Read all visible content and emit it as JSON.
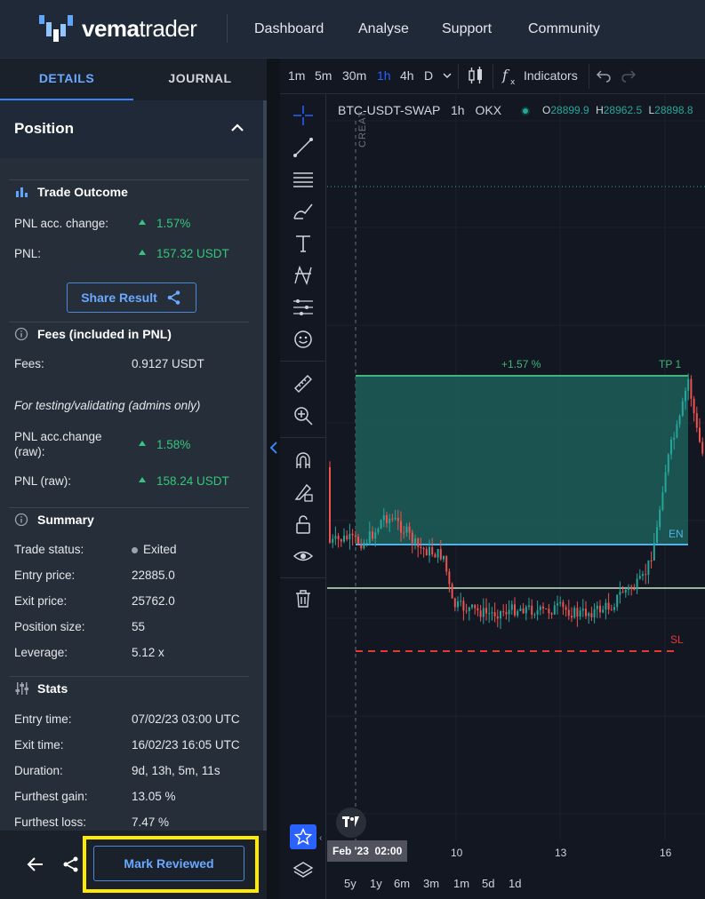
{
  "brand": {
    "name_light": "vema",
    "name_bold": "trader"
  },
  "nav": [
    "Dashboard",
    "Analyse",
    "Support",
    "Community"
  ],
  "tabs": {
    "details": "DETAILS",
    "journal": "JOURNAL"
  },
  "position": {
    "title": "Position"
  },
  "trade_outcome": {
    "title": "Trade Outcome",
    "pnl_acc_label": "PNL acc. change:",
    "pnl_acc_value": "1.57%",
    "pnl_label": "PNL:",
    "pnl_value": "157.32 USDT",
    "share_label": "Share Result"
  },
  "fees": {
    "title": "Fees (included in PNL)",
    "fees_label": "Fees:",
    "fees_value": "0.9127 USDT",
    "testing_note": "For testing/validating (admins only)",
    "pnl_raw_acc_label_1": "PNL acc.change",
    "pnl_raw_acc_label_2": "(raw):",
    "pnl_raw_acc_value": "1.58%",
    "pnl_raw_label": "PNL (raw):",
    "pnl_raw_value": "158.24 USDT"
  },
  "summary": {
    "title": "Summary",
    "rows": [
      {
        "label": "Trade status:",
        "value": "Exited"
      },
      {
        "label": "Entry price:",
        "value": "22885.0"
      },
      {
        "label": "Exit price:",
        "value": "25762.0"
      },
      {
        "label": "Position size:",
        "value": "55"
      },
      {
        "label": "Leverage:",
        "value": "5.12 x"
      }
    ]
  },
  "stats": {
    "title": "Stats",
    "rows": [
      {
        "label": "Entry time:",
        "value": "07/02/23 03:00 UTC"
      },
      {
        "label": "Exit time:",
        "value": "16/02/23 16:05 UTC"
      },
      {
        "label": "Duration:",
        "value": "9d, 13h, 5m, 11s"
      },
      {
        "label": "Furthest gain:",
        "value": "13.05 %"
      },
      {
        "label": "Furthest loss:",
        "value": "7.47 %"
      }
    ]
  },
  "bottom": {
    "mark_reviewed": "Mark Reviewed"
  },
  "chart_toolbar": {
    "timeframes": [
      "1m",
      "5m",
      "30m",
      "1h",
      "4h",
      "D"
    ],
    "active_timeframe": "1h",
    "indicators": "Indicators"
  },
  "chart_header": {
    "symbol": "BTC-USDT-SWAP",
    "interval": "1h",
    "exchange": "OKX",
    "o_label": "O",
    "o_value": "28899.9",
    "h_label": "H",
    "h_value": "28962.5",
    "l_label": "L",
    "l_value": "28898.8",
    "created_label": "CREAT"
  },
  "chart_annotations": {
    "pnl_pct": "+1.57 %",
    "tp": "TP 1",
    "en": "EN",
    "sl": "SL"
  },
  "xaxis": {
    "highlight_date": "Feb '23",
    "highlight_time": "02:00",
    "ticks": [
      "10",
      "13",
      "16"
    ]
  },
  "ranges": [
    "5y",
    "1y",
    "6m",
    "3m",
    "1m",
    "5d",
    "1d"
  ],
  "colors": {
    "accent": "#3b82f6",
    "green": "#34c77b",
    "tp_line": "#3fb67a",
    "en_line": "#4fb3e8",
    "sl_line": "#e53935",
    "profit_zone": "#1c5e58"
  },
  "chart_data": {
    "type": "candlestick",
    "symbol": "BTC-USDT-SWAP",
    "interval": "1h",
    "levels": {
      "tp": 25762.0,
      "entry": 22885.0,
      "sl": "below entry"
    },
    "x_ticks": [
      "Feb '23 02:00",
      "10",
      "13",
      "16"
    ]
  }
}
